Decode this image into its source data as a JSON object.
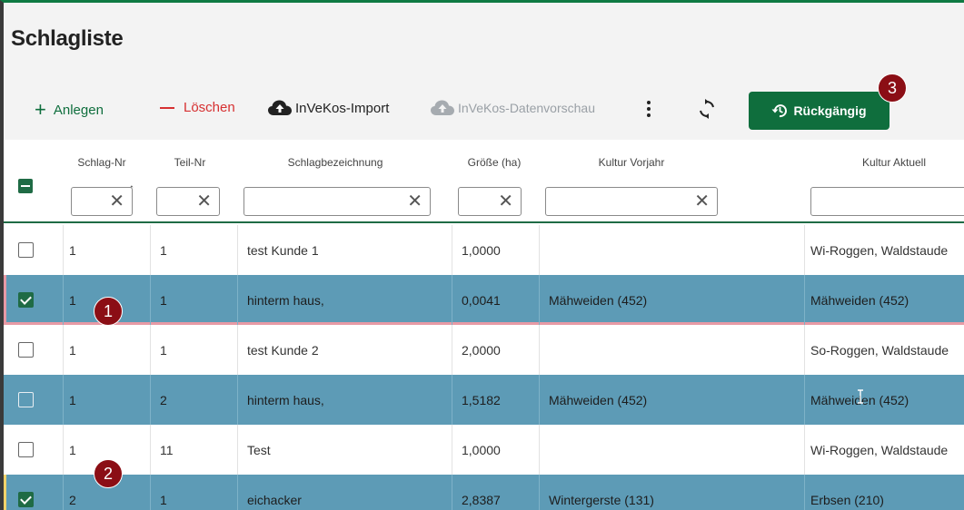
{
  "page": {
    "title": "Schlagliste"
  },
  "toolbar": {
    "add_label": "Anlegen",
    "delete_label": "Löschen",
    "import_label": "InVeKos-Import",
    "preview_label": "InVeKos-Datenvorschau",
    "undo_label": "Rückgängig"
  },
  "badges": {
    "one": "1",
    "two": "2",
    "three": "3"
  },
  "table": {
    "columns": [
      "Schlag-Nr",
      "Teil-Nr",
      "Schlagbezeichnung",
      "Größe (ha)",
      "Kultur Vorjahr",
      "Kultur Aktuell"
    ],
    "sort_icon": "arrow-up-icon",
    "filter_clear_glyph": "✕",
    "rows": [
      {
        "schlag": "1",
        "teil": "1",
        "bez": "test Kunde 1",
        "groesse": "1,0000",
        "vorjahr": "",
        "aktuell": "Wi-Roggen, Waldstaude"
      },
      {
        "schlag": "1",
        "teil": "1",
        "bez": "hinterm haus,",
        "groesse": "0,0041",
        "vorjahr": "Mähweiden (452)",
        "aktuell": "Mähweiden (452)"
      },
      {
        "schlag": "1",
        "teil": "1",
        "bez": "test Kunde 2",
        "groesse": "2,0000",
        "vorjahr": "",
        "aktuell": "So-Roggen, Waldstaude"
      },
      {
        "schlag": "1",
        "teil": "2",
        "bez": "hinterm haus,",
        "groesse": "1,5182",
        "vorjahr": "Mähweiden (452)",
        "aktuell": "Mähweiden (452)"
      },
      {
        "schlag": "1",
        "teil": "11",
        "bez": "Test",
        "groesse": "1,0000",
        "vorjahr": "",
        "aktuell": "Wi-Roggen, Waldstaude"
      },
      {
        "schlag": "2",
        "teil": "1",
        "bez": "eichacker",
        "groesse": "2,8387",
        "vorjahr": "Wintergerste (131)",
        "aktuell": "Erbsen (210)"
      }
    ]
  },
  "colors": {
    "brand_green": "#0f6e3d",
    "selected_row": "#5d9bb6",
    "badge": "#8b0e15",
    "delete_red": "#d63031"
  }
}
